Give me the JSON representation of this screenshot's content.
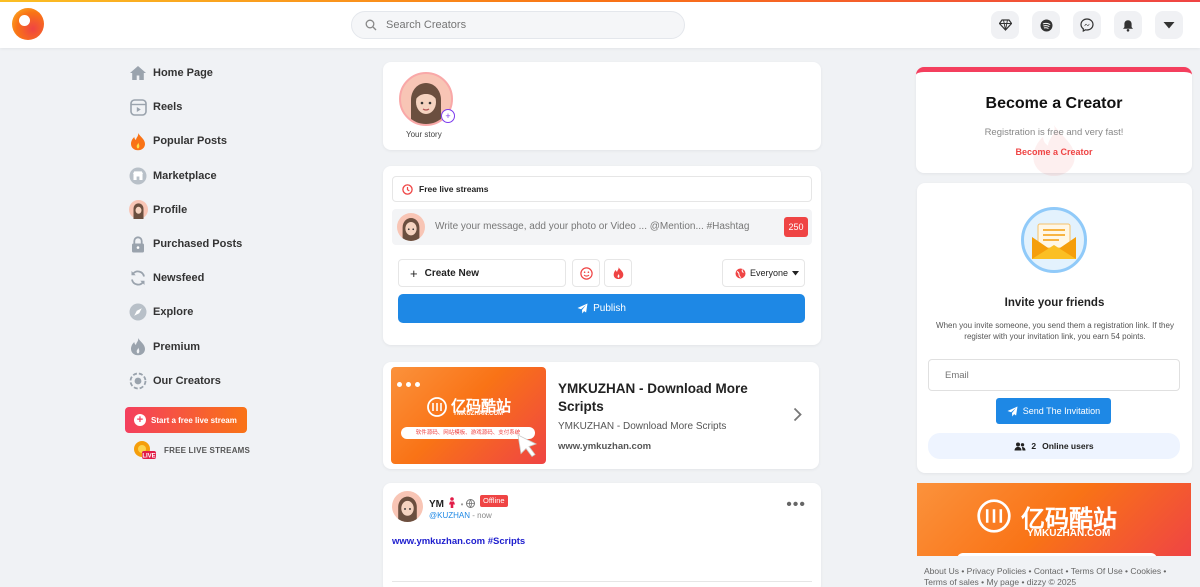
{
  "search": {
    "placeholder": "Search Creators"
  },
  "topbar": {
    "icons": [
      "diamond-icon",
      "spotify-icon",
      "messenger-icon",
      "bell-icon",
      "dropdown-caret-icon"
    ]
  },
  "sidebar": {
    "items": [
      {
        "label": "Home Page",
        "icon": "home-icon"
      },
      {
        "label": "Reels",
        "icon": "reels-icon"
      },
      {
        "label": "Popular Posts",
        "icon": "fire-icon"
      },
      {
        "label": "Marketplace",
        "icon": "store-icon"
      },
      {
        "label": "Profile",
        "icon": "profile-avatar"
      },
      {
        "label": "Purchased Posts",
        "icon": "lock-icon"
      },
      {
        "label": "Newsfeed",
        "icon": "sync-icon"
      },
      {
        "label": "Explore",
        "icon": "compass-icon"
      },
      {
        "label": "Premium",
        "icon": "flame-icon"
      },
      {
        "label": "Our Creators",
        "icon": "creators-icon"
      }
    ],
    "live_button": "Start a free live stream",
    "free_streams": "FREE LIVE STREAMS",
    "free_streams_badge": "LIVE"
  },
  "story": {
    "label": "Your story"
  },
  "composer": {
    "live_label": "Free live streams",
    "placeholder": "Write your message, add your photo or Video ... @Mention... #Hashtag",
    "char_count": "250",
    "create_new": "Create New",
    "audience": "Everyone",
    "publish": "Publish"
  },
  "ad_post": {
    "image_brand": "亿码酷站",
    "image_domain": "YMKUZHAN.COM",
    "image_tagline": "软件源码、网站模板、游戏源码、支付系统",
    "title": "YMKUZHAN - Download More Scripts",
    "subtitle": "YMKUZHAN - Download More Scripts",
    "url": "www.ymkuzhan.com"
  },
  "post": {
    "name": "YM",
    "status": "Offline",
    "handle": "@KUZHAN",
    "time": "- now",
    "text": "www.ymkuzhan.com #Scripts"
  },
  "creator_card": {
    "title": "Become a Creator",
    "subtitle": "Registration is free and very fast!",
    "link": "Become a Creator"
  },
  "invite": {
    "title": "Invite your friends",
    "description": "When you invite someone, you send them a registration link. If they register with your invitation link, you earn 54 points.",
    "email_placeholder": "Email",
    "send_button": "Send The Invitation",
    "online_count": "2",
    "online_label": "Online users"
  },
  "bottom_ad": {
    "brand": "亿码酷站",
    "domain": "YMKUZHAN.COM"
  },
  "footer": {
    "line1": "About Us • Privacy Policies • Contact • Terms Of Use • Cookies •",
    "line2": "Terms of sales • My page • dizzy © 2025"
  },
  "colors": {
    "accent_red": "#ef4444",
    "accent_blue": "#1e88e5",
    "accent_orange": "#f97316"
  }
}
